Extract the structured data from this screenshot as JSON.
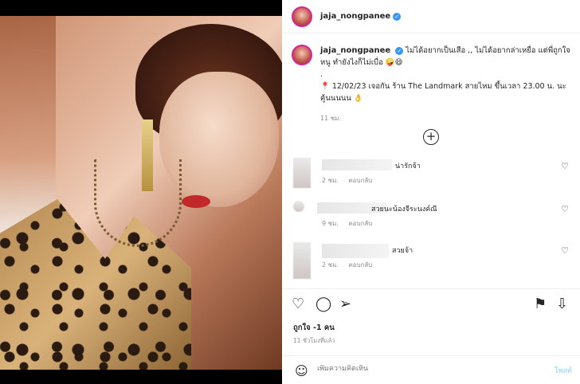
{
  "post": {
    "username": "jaja_nongpanee",
    "caption_line1": "ไม่ได้อยากเป็นเสือ ,, ไม่ได้อยากล่าเหยื่อ แต่พี่ถูกใจหนู ทำยังไงก็ไม่เบื่อ 🤪😄",
    "caption_dot": ".",
    "caption_line2": "📍 12/02/23 เจอกัน ร้าน The Landmark สายไหม ขึ้นเวลา 23.00 น. นะคู้นนนนน 👌",
    "caption_time": "11 ชม.",
    "likes": "ถูกใจ -1 คน",
    "posted_ago": "11 ชั่วโมงที่แล้ว"
  },
  "comments": [
    {
      "text": "น่ารักจ้า",
      "time": "2 ชม.",
      "reply": "ตอบกลับ"
    },
    {
      "text": "สวยนะน้องจีระนงค์ณี",
      "time": "9 ชม.",
      "reply": "ตอบกลับ"
    },
    {
      "text": "สวยจ้า",
      "time": "2 ชม.",
      "reply": "ตอบกลับ"
    }
  ],
  "composer": {
    "placeholder": "เพิ่มความคิดเห็น",
    "post_label": "โพสต์"
  },
  "icons": {
    "heart": "heart-icon",
    "comment": "comment-icon",
    "share": "share-icon",
    "save": "bookmark-icon",
    "download": "download-icon",
    "emoji": "emoji-icon",
    "more": "plus-circle-icon"
  },
  "colors": {
    "verified": "#3897f0",
    "muted": "#8e8e8e",
    "post_button": "#b2dffc"
  }
}
